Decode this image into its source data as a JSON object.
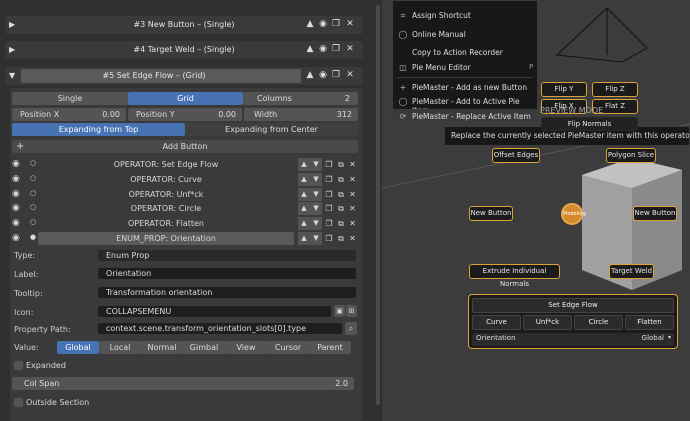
{
  "panel": {
    "item3": {
      "title": "#3  New Button – (Single)"
    },
    "item4": {
      "title": "#4  Target Weld – (Single)"
    },
    "item5": {
      "title": "#5  Set Edge Flow – (Grid)"
    },
    "layout_tabs": [
      "Single",
      "Grid",
      "Columns"
    ],
    "columns_value": "2",
    "pos_x_label": "Position X",
    "pos_x_value": "0.00",
    "pos_y_label": "Position Y",
    "pos_y_value": "0.00",
    "width_label": "Width",
    "width_value": "312",
    "expand_tabs": [
      "Expanding from Top",
      "Expanding from Center"
    ],
    "add_button": "Add Button",
    "sub_items": [
      {
        "label": "OPERATOR: Set Edge Flow",
        "dot": "○"
      },
      {
        "label": "OPERATOR: Curve",
        "dot": "○"
      },
      {
        "label": "OPERATOR: Unf*ck",
        "dot": "○"
      },
      {
        "label": "OPERATOR: Circle",
        "dot": "○"
      },
      {
        "label": "OPERATOR: Flatten",
        "dot": "○"
      },
      {
        "label": "ENUM_PROP: Orientation",
        "dot": "●"
      }
    ],
    "type_label": "Type:",
    "type_value": "Enum Prop",
    "label_label": "Label:",
    "label_value": "Orientation",
    "tooltip_label": "Tooltip:",
    "tooltip_value": "Transformation orientation",
    "icon_label": "Icon:",
    "icon_value": "COLLAPSEMENU",
    "path_label": "Property Path:",
    "path_value": "context.scene.transform_orientation_slots[0].type",
    "value_label": "Value:",
    "value_options": [
      "Global",
      "Local",
      "Normal",
      "Gimbal",
      "View",
      "Cursor",
      "Parent"
    ],
    "expanded_label": "Expanded",
    "colspan_label": "Col Span",
    "colspan_value": "2.0",
    "outside_label": "Outside Section"
  },
  "menu": {
    "items": [
      "Assign Shortcut",
      "Online Manual",
      "Copy to Action Recorder",
      "Pie Menu Editor",
      "PieMaster - Add as new Button",
      "PieMaster - Add to Active Pie Item",
      "PieMaster - Replace Active Item"
    ],
    "pie_menu_shortcut": "P",
    "tooltip": "Replace the currently selected PieMaster item with this operator or prop"
  },
  "viewport": {
    "flip_y": "Flip Y",
    "flip_z": "Flip Z",
    "flip_x": "Flip X",
    "flip_z2": "Flat Z",
    "preview_mode": "PREVIEW MODE",
    "flip_normals": "Flip Normals",
    "offset_edges": "Offset Edges",
    "polygon_slice": "Polygon Slice",
    "new_button_left": "New Button",
    "new_button_right": "New Button",
    "center": "Modeling",
    "extrude": "Extrude Individual Normals",
    "target_weld": "Target Weld",
    "grid_title": "Set Edge Flow",
    "grid_buttons": [
      "Curve",
      "Unf*ck",
      "Circle",
      "Flatten"
    ],
    "orientation_label": "Orientation",
    "orientation_value": "Global"
  }
}
